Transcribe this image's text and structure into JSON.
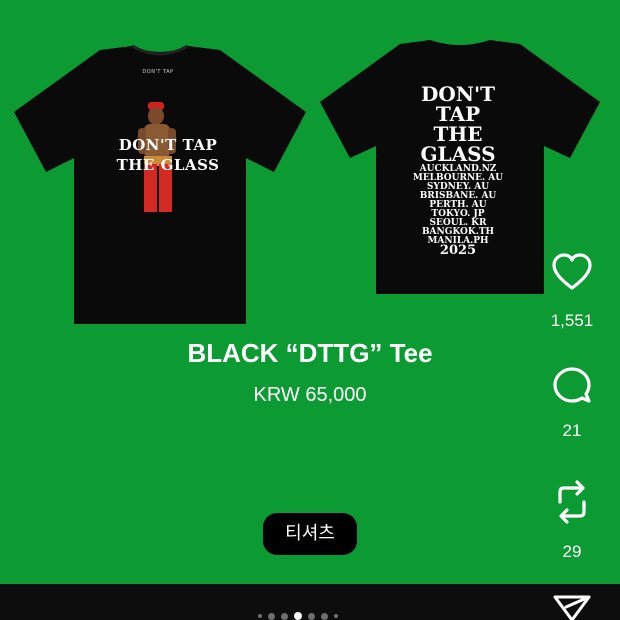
{
  "images": {
    "front": {
      "brand_tag": "DON'T TAP",
      "print_line1": "DON'T TAP",
      "print_line2": "THE GLASS"
    },
    "back": {
      "headline": [
        "DON'T",
        "TAP",
        "THE",
        "GLASS"
      ],
      "cities": [
        "AUCKLAND.NZ",
        "MELBOURNE. AU",
        "SYDNEY. AU",
        "BRISBANE. AU",
        "PERTH. AU",
        "TOKYO. JP",
        "SEOUL. KR",
        "BANGKOK.TH",
        "MANILA.PH"
      ],
      "year": "2025"
    }
  },
  "product": {
    "title": "BLACK “DTTG” Tee",
    "price": "KRW 65,000",
    "category": "티셔츠"
  },
  "actions": {
    "like_count": "1,551",
    "comment_count": "21",
    "repost_count": "29"
  },
  "carousel": {
    "total": 7,
    "active_index": 3
  },
  "colors": {
    "background": "#0c9a33",
    "shirt": "#0a0a0a",
    "chip": "#000000",
    "bottom_bar": "#0d0d0d"
  },
  "icons": [
    "heart-icon",
    "comment-icon",
    "repost-icon",
    "share-icon"
  ]
}
